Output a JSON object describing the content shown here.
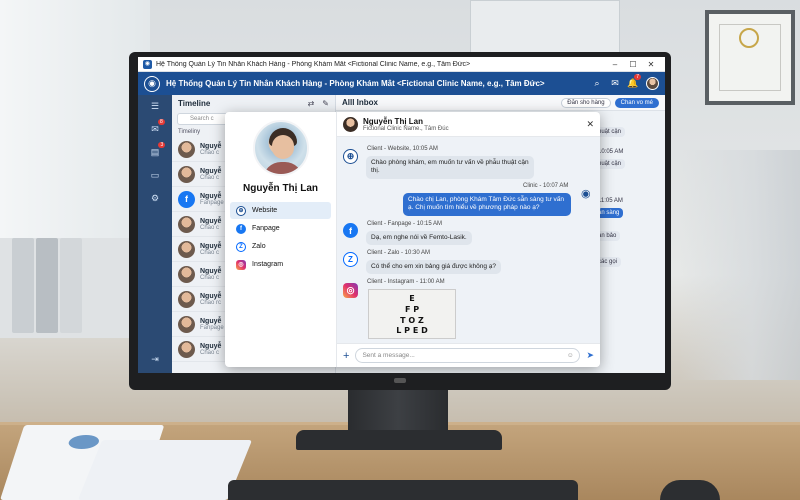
{
  "window": {
    "title": "Hệ Thống Quản Lý Tin Nhắn Khách Hàng - Phòng Khám Mắt <Fictional Clinic Name, e.g., Tâm Đức>",
    "minimize": "–",
    "maximize": "☐",
    "close": "✕"
  },
  "header": {
    "title": "Hệ Thống Quản Lý Tin Nhắn Khách Hàng - Phòng Khám Mắt <Fictional Clinic Name, e.g., Tâm Đức>",
    "notification_count": "7"
  },
  "rail": {
    "badge_1": "8",
    "badge_2": "3"
  },
  "timeline": {
    "title": "Timeline",
    "search_placeholder": "Search c",
    "section": "Timeliny",
    "items": [
      {
        "name": "Nguyễ",
        "source": "Chào c"
      },
      {
        "name": "Nguyễ",
        "source": "Chào c"
      },
      {
        "name": "Nguyễ",
        "source": "Fanpage"
      },
      {
        "name": "Nguyễ",
        "source": "Chào c"
      },
      {
        "name": "Nguyễ",
        "source": "Chào c"
      },
      {
        "name": "Nguyễ",
        "source": "Chào c"
      },
      {
        "name": "Nguyễ",
        "source": "Chao rc"
      },
      {
        "name": "Nguyễ",
        "source": "Fanpage"
      },
      {
        "name": "Nguyễ",
        "source": "Chào c"
      }
    ]
  },
  "inbox": {
    "title": "Alll Inbox",
    "filter_label": "Đăn sho hàng",
    "assign_label": "Chan vo mé",
    "bg_messages": [
      "huật cận",
      "10:05 AM",
      "huật cận",
      "11:05 AM",
      "ẫn sàng",
      "an bảo",
      "các gọi"
    ]
  },
  "modal": {
    "name": "Nguyễn Thị Lan",
    "clinic": "Fictional Clinic Name., Tâm Đúc",
    "channels": [
      "Website",
      "Fanpage",
      "Zalo",
      "Instagram"
    ],
    "messages": [
      {
        "meta": "Client - Website, 10:05 AM",
        "text": "Chào phòng khám, em muốn tư vấn về phẫu thuật cận thị."
      },
      {
        "meta": "Clinic - 10:07 AM",
        "text": "Chào chị Lan, phòng Khám Tâm Đức sẵn sàng tư vấn ạ. Chị muốn tìm hiểu về phương pháp nào ạ?"
      },
      {
        "meta": "Client - Fanpage - 10:15 AM",
        "text": "Dạ, em nghe nói về Femto-Lasik."
      },
      {
        "meta": "Client - Zalo - 10:30 AM",
        "text": "Có thể cho em xin bảng giá được không ạ?"
      },
      {
        "meta": "Client - Instagram - 11:00 AM",
        "text": ""
      }
    ],
    "eye_chart_lines": [
      "E",
      "F P",
      "T O Z",
      "L P E D"
    ],
    "input_placeholder": "Sent a message..."
  },
  "icons": {
    "brand": "eye-icon",
    "search": "search-icon",
    "mail": "mail-icon",
    "bell": "bell-icon",
    "close": "close-icon",
    "send": "send-icon",
    "emoji": "emoji-icon",
    "plus": "plus-icon"
  },
  "colors": {
    "header_blue": "#1c4f93",
    "rail_blue": "#2b4a73",
    "outgoing_bubble": "#2f6fd0",
    "badge_red": "#e53935"
  }
}
